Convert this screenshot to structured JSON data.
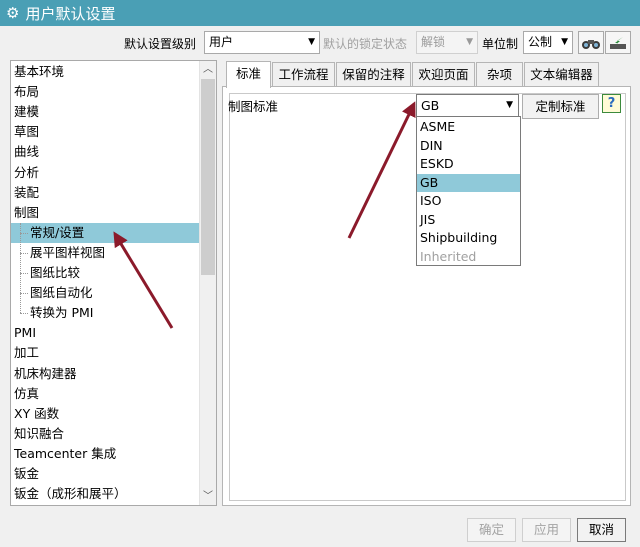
{
  "window": {
    "title": "用户默认设置"
  },
  "toolbar": {
    "level_label": "默认设置级别",
    "level_value": "用户",
    "lock_label": "默认的锁定状态",
    "lock_value": "解锁",
    "unit_label": "单位制",
    "unit_value": "公制"
  },
  "tree": {
    "items": [
      {
        "label": "基本环境",
        "child": false
      },
      {
        "label": "布局",
        "child": false
      },
      {
        "label": "建模",
        "child": false
      },
      {
        "label": "草图",
        "child": false
      },
      {
        "label": "曲线",
        "child": false
      },
      {
        "label": "分析",
        "child": false
      },
      {
        "label": "装配",
        "child": false
      },
      {
        "label": "制图",
        "child": false
      },
      {
        "label": "常规/设置",
        "child": true,
        "selected": true
      },
      {
        "label": "展平图样视图",
        "child": true
      },
      {
        "label": "图纸比较",
        "child": true
      },
      {
        "label": "图纸自动化",
        "child": true
      },
      {
        "label": "转换为 PMI",
        "child": true
      },
      {
        "label": "PMI",
        "child": false
      },
      {
        "label": "加工",
        "child": false
      },
      {
        "label": "机床构建器",
        "child": false
      },
      {
        "label": "仿真",
        "child": false
      },
      {
        "label": "XY 函数",
        "child": false
      },
      {
        "label": "知识融合",
        "child": false
      },
      {
        "label": "Teamcenter 集成",
        "child": false
      },
      {
        "label": "钣金",
        "child": false
      },
      {
        "label": "钣金（成形和展平）",
        "child": false
      }
    ]
  },
  "tabs": [
    "标准",
    "工作流程",
    "保留的注释",
    "欢迎页面",
    "杂项",
    "文本编辑器"
  ],
  "standard": {
    "label": "制图标准",
    "value": "GB",
    "custom_button": "定制标准",
    "help": "?",
    "options": [
      {
        "label": "ASME"
      },
      {
        "label": "DIN"
      },
      {
        "label": "ESKD"
      },
      {
        "label": "GB",
        "selected": true
      },
      {
        "label": "ISO"
      },
      {
        "label": "JIS"
      },
      {
        "label": "Shipbuilding"
      },
      {
        "label": "Inherited",
        "disabled": true
      }
    ]
  },
  "footer": {
    "ok": "确定",
    "apply": "应用",
    "cancel": "取消"
  },
  "colors": {
    "titlebar": "#4a9fb5",
    "selection": "#8fc9d9",
    "annotation_arrow": "#8b1a2b"
  }
}
